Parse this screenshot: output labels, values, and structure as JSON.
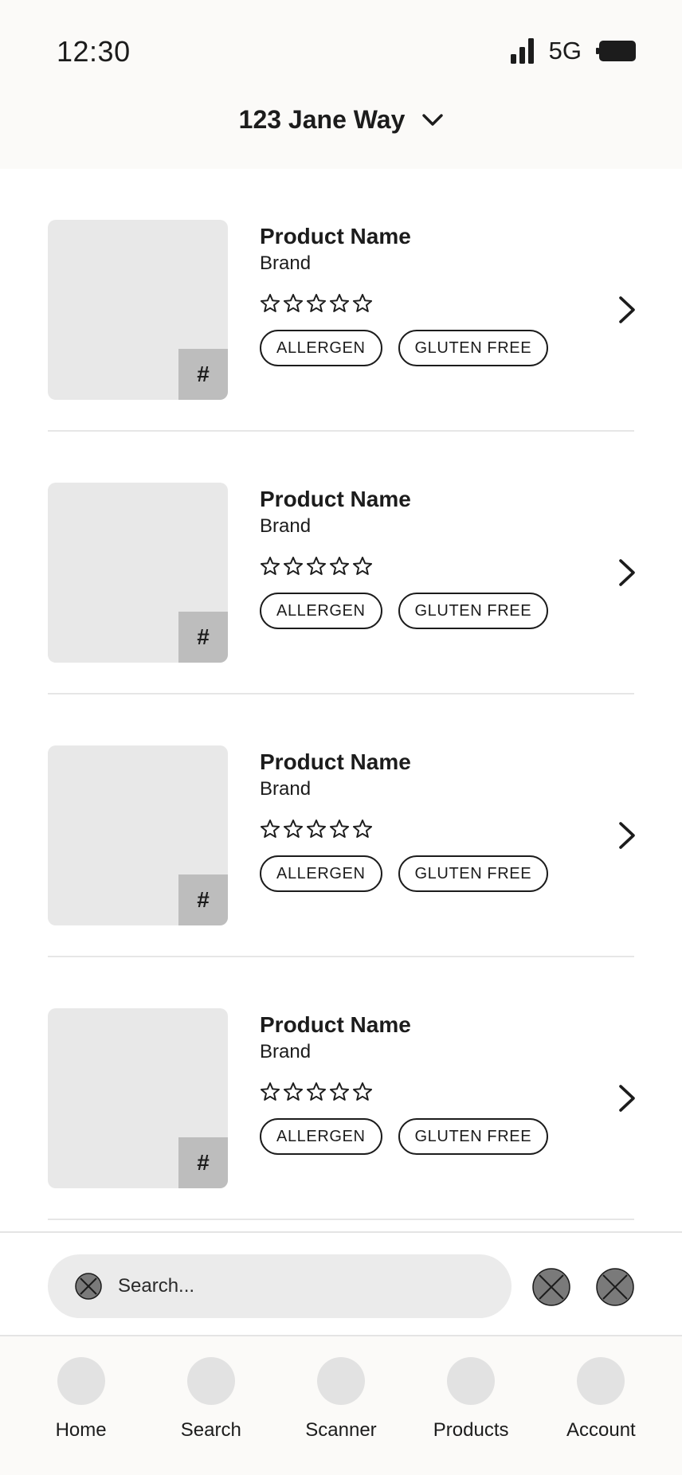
{
  "status_bar": {
    "time": "12:30",
    "network": "5G",
    "signal_icon": "signal-bars-icon",
    "battery_icon": "battery-icon"
  },
  "header": {
    "location": "123 Jane Way",
    "dropdown_icon": "chevron-down-icon"
  },
  "products": [
    {
      "name": "Product Name",
      "brand": "Brand",
      "badge": "#",
      "rating": 0,
      "max_rating": 5,
      "tags": [
        "ALLERGEN",
        "GLUTEN FREE"
      ]
    },
    {
      "name": "Product Name",
      "brand": "Brand",
      "badge": "#",
      "rating": 0,
      "max_rating": 5,
      "tags": [
        "ALLERGEN",
        "GLUTEN FREE"
      ]
    },
    {
      "name": "Product Name",
      "brand": "Brand",
      "badge": "#",
      "rating": 0,
      "max_rating": 5,
      "tags": [
        "ALLERGEN",
        "GLUTEN FREE"
      ]
    },
    {
      "name": "Product Name",
      "brand": "Brand",
      "badge": "#",
      "rating": 0,
      "max_rating": 5,
      "tags": [
        "ALLERGEN",
        "GLUTEN FREE"
      ]
    }
  ],
  "search": {
    "placeholder": "Search...",
    "value": ""
  },
  "nav": {
    "items": [
      {
        "label": "Home"
      },
      {
        "label": "Search"
      },
      {
        "label": "Scanner"
      },
      {
        "label": "Products"
      },
      {
        "label": "Account"
      }
    ]
  },
  "colors": {
    "header_bg": "#fbfaf8",
    "image_placeholder": "#e8e8e8",
    "badge_bg": "#bdbdbd",
    "search_bg": "#ebebeb",
    "icon_fill": "#7a7a7a",
    "nav_icon": "#e2e2e2",
    "text": "#1c1c1c"
  }
}
